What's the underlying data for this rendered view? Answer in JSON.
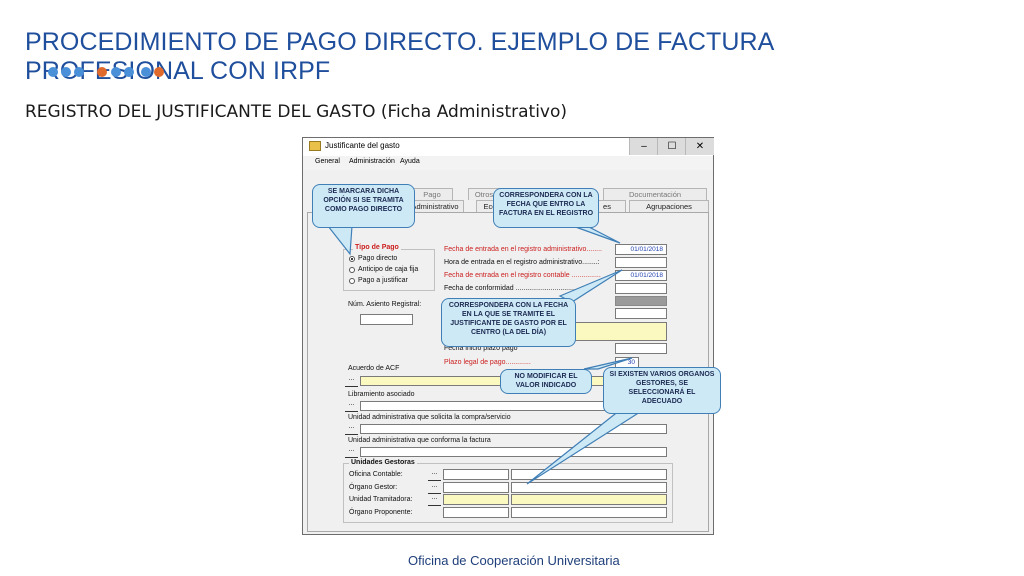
{
  "slide": {
    "title": "PROCEDIMIENTO DE PAGO DIRECTO. EJEMPLO DE FACTURA PROFESIONAL CON IRPF",
    "subtitle": "REGISTRO DEL JUSTIFICANTE DEL GASTO (Ficha  Administrativo)",
    "footer": "Oficina de Cooperación Universitaria",
    "dot_colors": [
      "#4a90d9",
      "#4a90d9",
      "#4a90d9",
      "#e06a2c",
      "#4a90d9",
      "#4a90d9",
      "#4a90d9",
      "#e06a2c"
    ]
  },
  "window": {
    "title": "Justificante del gasto",
    "buttons": {
      "minimize": "‒",
      "maximize": "☐",
      "close": "✕"
    },
    "menu": [
      "General",
      "Administración",
      "Ayuda"
    ],
    "tabs_back": [
      "Pago",
      "Otros",
      "Documentación"
    ],
    "tabs_front": [
      "Administrativo",
      "Eco",
      "es",
      "Agrupaciones"
    ],
    "tipo_pago": {
      "label": "Tipo de Pago",
      "options": [
        "Pago directo",
        "Anticipo de caja fija",
        "Pago a justificar"
      ],
      "selected": 0
    },
    "num_asiento_label": "Núm. Asiento Registral:",
    "fields": [
      {
        "label": "Fecha de entrada en el registro administrativo........",
        "value": "01/01/2018",
        "red": true
      },
      {
        "label": "Hora de entrada en el registro administrativo........:",
        "value": "",
        "red": false
      },
      {
        "label": "Fecha de entrada en el registro contable ...............",
        "value": "01/01/2018",
        "red": true
      },
      {
        "label": "Fecha de conformidad ......................................",
        "value": "",
        "red": false
      }
    ],
    "fecha_inicio_label": "Fecha inicio plazo pago",
    "plazo_legal": {
      "label": "Plazo legal de pago.............",
      "value": "30"
    },
    "acuerdo_acf_label": "Acuerdo de ACF",
    "libramiento_label": "Libramiento asociado",
    "unidad_solicita_label": "Unidad administrativa que solicita la compra/servicio",
    "unidad_conforma_label": "Unidad administrativa que conforma la factura",
    "unidades_gestoras": {
      "legend": "Unidades Gestoras",
      "rows": [
        "Oficina Contable:",
        "Órgano Gestor:",
        "Unidad Tramitadora:",
        "Órgano Proponente:"
      ]
    },
    "ellipsis": "..."
  },
  "callouts": {
    "pago_directo": "SE MARCARA DICHA OPCIÓN SI SE TRAMITA COMO PAGO DIRECTO",
    "fecha_registro": "CORRESPONDERA CON LA FECHA QUE ENTRO LA FACTURA EN EL REGISTRO",
    "fecha_centro": "CORRESPONDERA CON LA FECHA EN LA QUE SE TRAMITE EL JUSTIFICANTE DE GASTO POR EL CENTRO (LA DEL DÍA)",
    "no_modificar": "NO MODIFICAR EL VALOR INDICADO",
    "organos": "SI EXISTEN VARIOS ORGANOS GESTORES, SE SELECCIONARÁ EL ADECUADO"
  }
}
